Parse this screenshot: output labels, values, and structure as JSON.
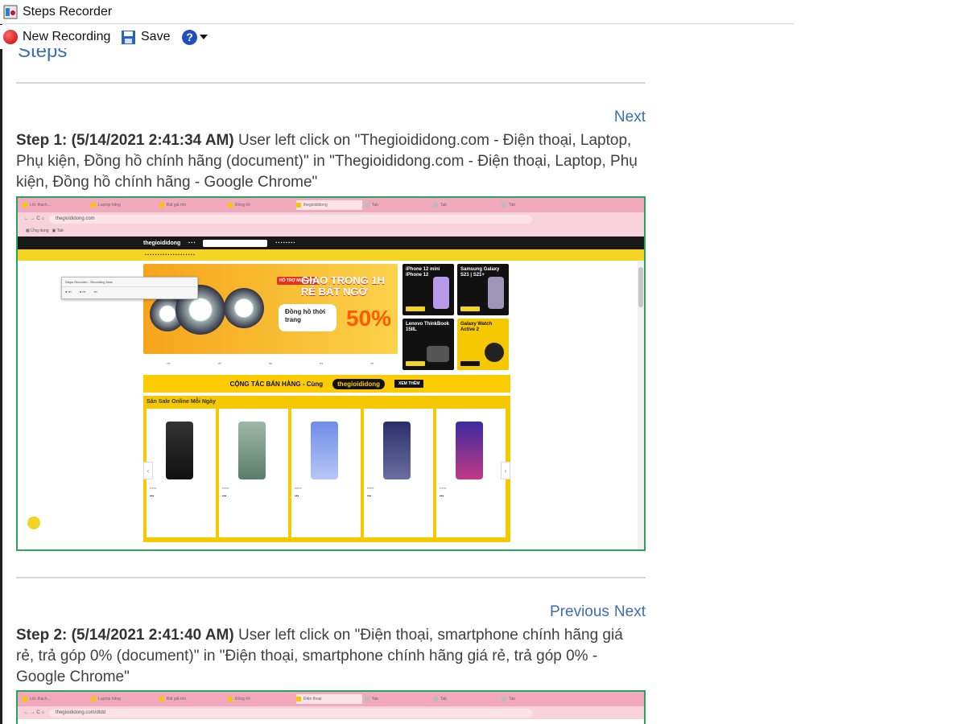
{
  "window": {
    "title": "Steps Recorder"
  },
  "toolbar": {
    "new_recording": "New Recording",
    "save": "Save",
    "help_symbol": "?"
  },
  "doc": {
    "heading": "Steps"
  },
  "step1": {
    "nav_next": "Next",
    "label": "Step 1: (5/14/2021 2:41:34 AM)",
    "text": " User left click on \"Thegioididong.com - Điện thoại, Laptop, Phụ kiện, Đồng hồ chính hãng (document)\" in \"Thegioididong.com - Điện thoại, Laptop, Phụ kiện, Đồng hồ chính hãng - Google Chrome\"",
    "screenshot": {
      "url": "thegioididong.com",
      "site_logo": "thegioididong",
      "banner_tag": "HỖ TRỢ MUA ĐƠN",
      "banner_line1": "GIAO TRONG 1H",
      "banner_line2": "RẺ BẤT NGỜ",
      "banner_pill": "Đồng hồ thời trang",
      "banner_pct": "50%",
      "promos": [
        "iPhone 12 mini iPhone 12",
        "Samsung Galaxy S21 | S21+",
        "Lenovo ThinkBook 15IIL",
        "Galaxy Watch Active 2"
      ],
      "cta_left": "CỘNG TÁC BÁN HÀNG - Cùng",
      "cta_brand": "thegioididong",
      "cta_button": "XEM THÊM",
      "sale_title": "Săn Sale Online Mỗi Ngày",
      "popup_title": "Steps Recorder - Recording Now"
    }
  },
  "step2": {
    "nav_previous": "Previous",
    "nav_next": "Next",
    "label": "Step 2: (5/14/2021 2:41:40 AM)",
    "text": " User left click on \"Điện thoại, smartphone chính hãng giá rẻ, trả góp 0% (document)\" in \"Điện thoại, smartphone chính hãng giá rẻ, trả góp 0% - Google Chrome\"",
    "screenshot": {
      "url": "thegioididong.com/dtdd"
    }
  },
  "colors": {
    "link_blue": "#3c6db3",
    "screenshot_border": "#27a560",
    "brand_yellow": "#f5d322"
  }
}
